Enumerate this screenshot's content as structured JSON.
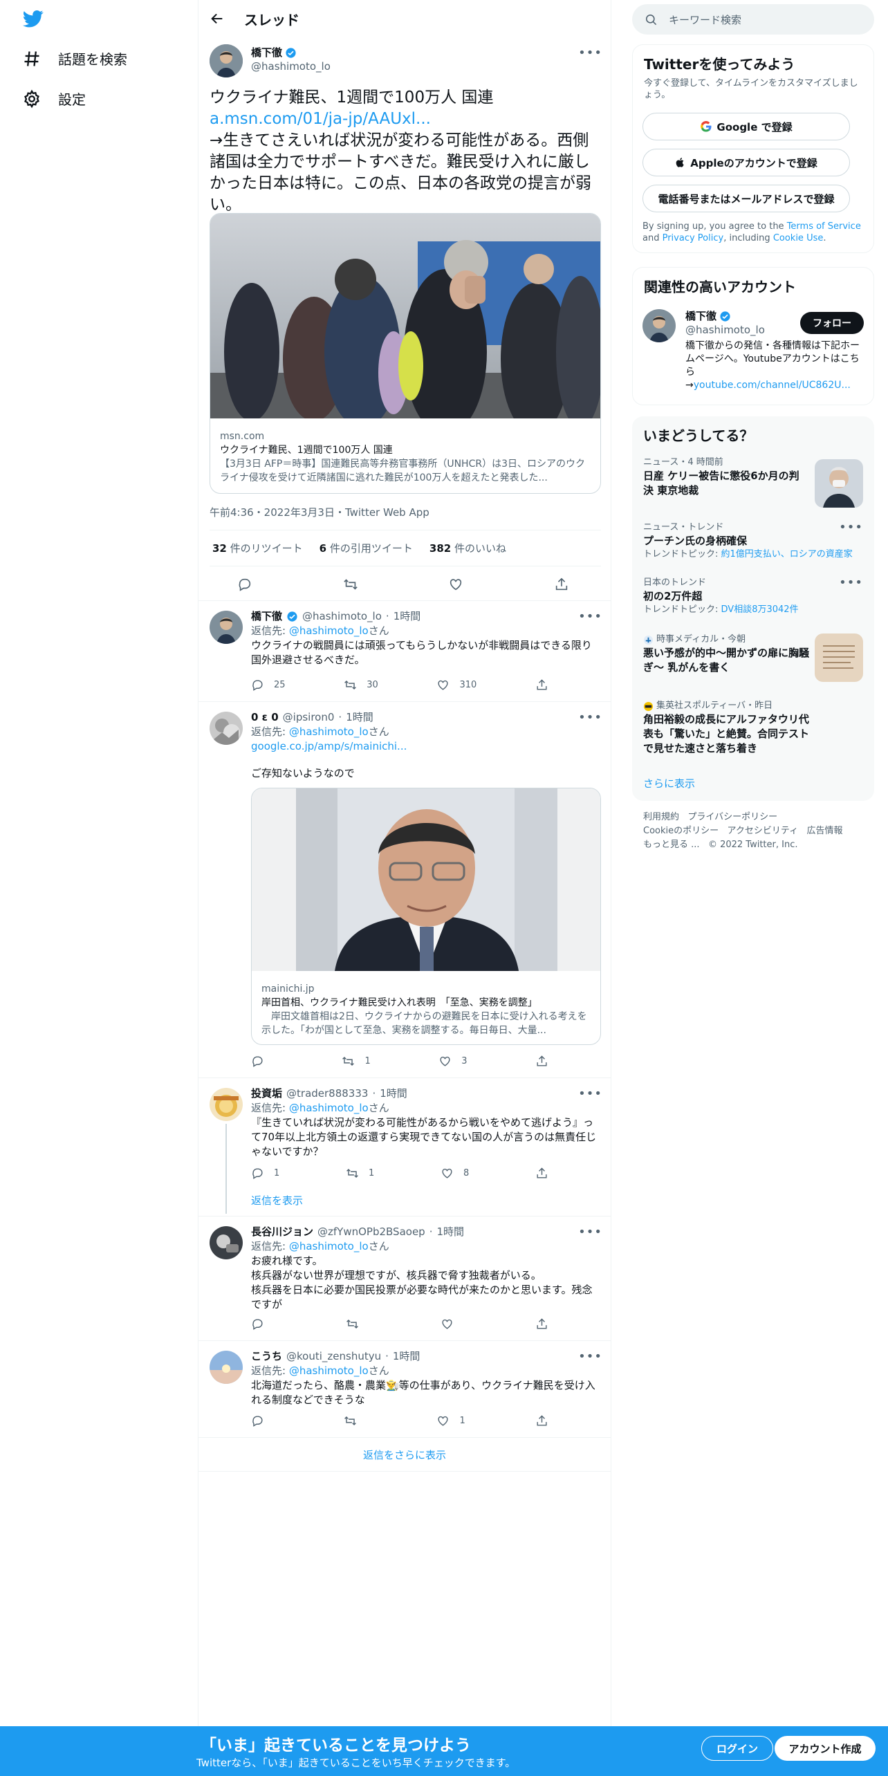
{
  "nav": {
    "explore_label": "話題を検索",
    "settings_label": "設定"
  },
  "thread": {
    "title": "スレッド"
  },
  "main_tweet": {
    "name": "橋下徹",
    "handle": "@hashimoto_lo",
    "text_line1": "ウクライナ難民、1週間で100万人 国連",
    "link": "a.msn.com/01/ja-jp/AAUxl...",
    "text_body": "→生きてさえいれば状況が変わる可能性がある。西側諸国は全力でサポートすべきだ。難民受け入れに厳しかった日本は特に。この点、日本の各政党の提言が弱い。",
    "card": {
      "domain": "msn.com",
      "title": "ウクライナ難民、1週間で100万人 国連",
      "desc": "【3月3日 AFP＝時事】国連難民高等弁務官事務所（UNHCR）は3日、ロシアのウクライナ侵攻を受けて近隣諸国に逃れた難民が100万人を超えたと発表した..."
    },
    "timestamp": "午前4:36・2022年3月3日・Twitter Web App",
    "retweets": "32",
    "retweets_label": "件のリツイート",
    "quotes": "6",
    "quotes_label": "件の引用ツイート",
    "likes": "382",
    "likes_label": "件のいいね"
  },
  "replies": [
    {
      "name": "橋下徹",
      "handle": "@hashimoto_lo",
      "time": "1時間",
      "replying_prefix": "返信先: ",
      "replying_to": "@hashimoto_lo",
      "replying_suffix": "さん",
      "text": "ウクライナの戦闘員には頑張ってもらうしかないが非戦闘員はできる限り国外退避させるべきだ。",
      "replies": "25",
      "retweets": "30",
      "likes": "310"
    },
    {
      "name": "0 ε 0",
      "handle": "@ipsiron0",
      "time": "1時間",
      "replying_prefix": "返信先: ",
      "replying_to": "@hashimoto_lo",
      "replying_suffix": "さん",
      "link": "google.co.jp/amp/s/mainichi...",
      "text": "ご存知ないようなので",
      "card": {
        "domain": "mainichi.jp",
        "title": "岸田首相、ウクライナ難民受け入れ表明　「至急、実務を調整」",
        "desc": "　岸田文雄首相は2日、ウクライナからの避難民を日本に受け入れる考えを示した。「わが国として至急、実務を調整する。毎日毎日、大量..."
      },
      "replies": "",
      "retweets": "1",
      "likes": "3"
    },
    {
      "name": "投資垢",
      "handle": "@trader888333",
      "time": "1時間",
      "replying_prefix": "返信先: ",
      "replying_to": "@hashimoto_lo",
      "replying_suffix": "さん",
      "text": "『生きていれば状況が変わる可能性があるから戦いをやめて逃げよう』って70年以上北方領土の返還すら実現できてない国の人が言うのは無責任じゃないですか？",
      "replies": "1",
      "retweets": "1",
      "likes": "8",
      "show_replies": "返信を表示"
    },
    {
      "name": "長谷川ジョン",
      "handle": "@zfYwnOPb2BSaoep",
      "time": "1時間",
      "replying_prefix": "返信先: ",
      "replying_to": "@hashimoto_lo",
      "replying_suffix": "さん",
      "text": "お疲れ様です。\n核兵器がない世界が理想ですが、核兵器で脅す独裁者がいる。\n核兵器を日本に必要か国民投票が必要な時代が来たのかと思います。残念ですが",
      "replies": "",
      "retweets": "",
      "likes": ""
    },
    {
      "name": "こうち",
      "handle": "@kouti_zenshutyu",
      "time": "1時間",
      "replying_prefix": "返信先: ",
      "replying_to": "@hashimoto_lo",
      "replying_suffix": "さん",
      "text": "北海道だったら、酪農・農業👨‍🌾等の仕事があり、ウクライナ難民を受け入れる制度などできそうな",
      "replies": "",
      "retweets": "",
      "likes": "1"
    }
  ],
  "more_replies": "返信をさらに表示",
  "search": {
    "placeholder": "キーワード検索"
  },
  "signup": {
    "title": "Twitterを使ってみよう",
    "subtitle": "今すぐ登録して、タイムラインをカスタマイズしましょう。",
    "google": "Google で登録",
    "apple": "Appleのアカウントで登録",
    "phone": "電話番号またはメールアドレスで登録",
    "terms_prefix": "By signing up, you agree to the ",
    "terms": "Terms of Service",
    "and": " and ",
    "privacy": "Privacy Policy",
    "including": ", including ",
    "cookie": "Cookie Use",
    "period": "."
  },
  "related": {
    "title": "関連性の高いアカウント",
    "name": "橋下徹",
    "handle": "@hashimoto_lo",
    "follow": "フォロー",
    "bio": "橋下徹からの発信・各種情報は下記ホームページへ。Youtubeアカウントはこちら",
    "bio_arrow": "→",
    "bio_link": "youtube.com/channel/UC862U..."
  },
  "trends": {
    "title": "いまどうしてる？",
    "items": [
      {
        "meta": "ニュース・4 時間前",
        "title": "日産 ケリー被告に懲役6か月の判決 東京地裁"
      },
      {
        "meta": "ニュース・トレンド",
        "title": "プーチン氏の身柄確保",
        "sub_prefix": "トレンドトピック: ",
        "sub": "約1億円支払い、ロシアの資産家"
      },
      {
        "meta": "日本のトレンド",
        "title": "初の2万件超",
        "sub_prefix": "トレンドトピック: ",
        "sub": "DV相談8万3042件"
      },
      {
        "meta": "時事メディカル・今朝",
        "title": "悪い予感が的中～開かずの扉に胸騒ぎ～ 乳がんを書く"
      },
      {
        "meta": "集英社スポルティーバ・昨日",
        "title": "角田裕毅の成長にアルファタウリ代表も「驚いた」と絶賛。合同テストで見せた速さと落ち着き"
      }
    ],
    "show_more": "さらに表示"
  },
  "footer": {
    "links": [
      "利用規約",
      "プライバシーポリシー",
      "Cookieのポリシー",
      "アクセシビリティ",
      "広告情報",
      "もっと見る ..."
    ],
    "copyright": "© 2022 Twitter, Inc."
  },
  "bottom_bar": {
    "title": "「いま」起きていることを見つけよう",
    "subtitle": "Twitterなら、「いま」起きていることをいち早くチェックできます。",
    "login": "ログイン",
    "signup": "アカウント作成"
  },
  "colors": {
    "accent": "#1d9bf0",
    "text": "#0f1419",
    "muted": "#536471",
    "border": "#eff3f4"
  }
}
